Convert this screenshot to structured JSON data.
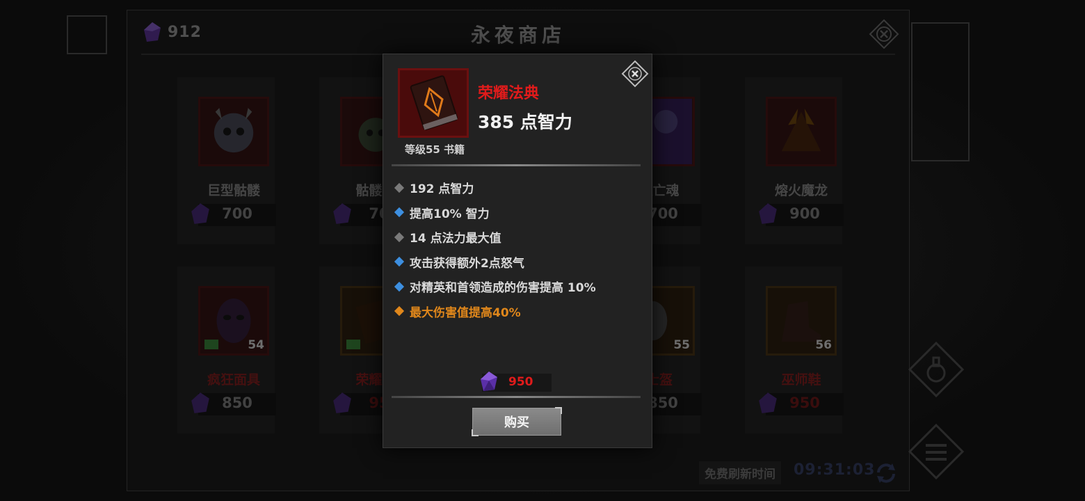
{
  "shop": {
    "currency_value": "912",
    "title": "永夜商店",
    "refresh_label": "免费刷新时间",
    "refresh_time": "09:31:03",
    "items": [
      {
        "name": "巨型骷髅",
        "price": "700"
      },
      {
        "name": "骷髅施",
        "price": "70"
      },
      {
        "name": "夜亡魂",
        "price": "700"
      },
      {
        "name": "熔火魔龙",
        "price": "900"
      },
      {
        "name": "疯狂面具",
        "price": "850",
        "level": "54"
      },
      {
        "name": "荣耀法",
        "price": "95"
      },
      {
        "name": "士盔",
        "price": "850",
        "level": "55"
      },
      {
        "name": "巫师鞋",
        "price": "950",
        "level": "56"
      }
    ]
  },
  "modal": {
    "item_name": "荣耀法典",
    "main_stat": "385 点智力",
    "level_type": "等级55 书籍",
    "stats": [
      {
        "text": "192 点智力",
        "tier": "base"
      },
      {
        "text": "提高10% 智力",
        "tier": "magic"
      },
      {
        "text": "14 点法力最大值",
        "tier": "base"
      },
      {
        "text": "攻击获得额外2点怒气",
        "tier": "magic"
      },
      {
        "text": "对精英和首领造成的伤害提高 10%",
        "tier": "magic"
      },
      {
        "text": "最大伤害值提高40%",
        "tier": "legendary"
      }
    ],
    "price": "950",
    "buy_label": "购买"
  },
  "colors": {
    "item_name": "#e01b1b",
    "legendary": "#e0871b",
    "magic_bullet": "#3d8fe0",
    "base_bullet": "#7a7a7a",
    "gem": "#7a3fd0"
  },
  "icons": {
    "currency": "purple-gem-icon",
    "close": "diamond-close-icon",
    "item": "tome-book-icon",
    "refresh": "refresh-icon"
  }
}
